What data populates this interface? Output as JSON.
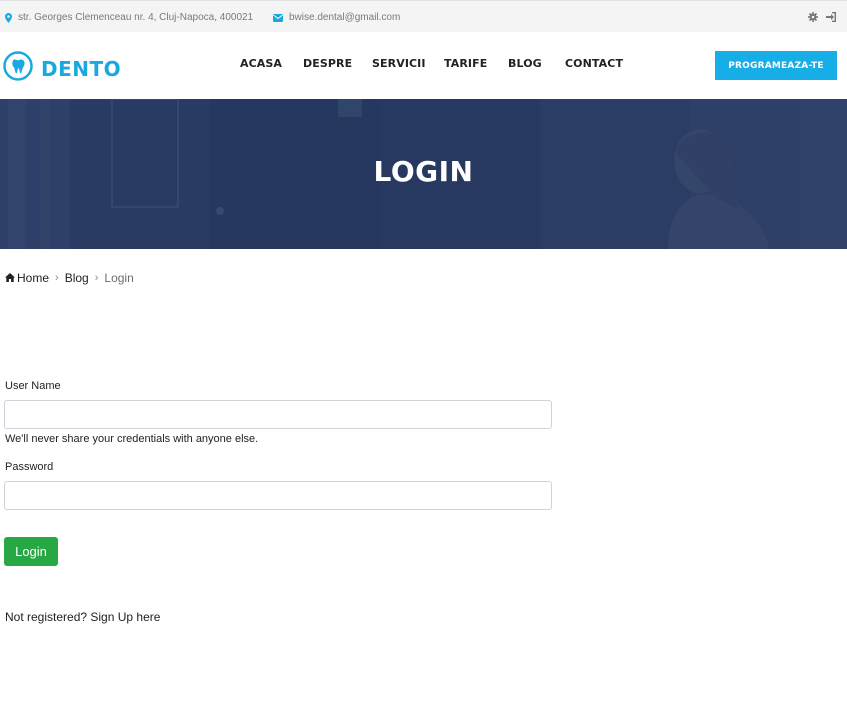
{
  "topbar": {
    "address": "str. Georges Clemenceau nr. 4, Cluj-Napoca, 400021",
    "email": "bwise.dental@gmail.com",
    "settings_icon": "gear-icon",
    "login_icon": "sign-in-icon"
  },
  "header": {
    "logo_text": "DENTO",
    "nav": [
      "ACASA",
      "DESPRE",
      "SERVICII",
      "TARIFE",
      "BLOG",
      "CONTACT"
    ],
    "cta_label": "PROGRAMEAZA-TE"
  },
  "hero": {
    "title": "LOGIN"
  },
  "breadcrumb": {
    "home": "Home",
    "blog": "Blog",
    "current": "Login"
  },
  "form": {
    "username_label": "User Name",
    "username_value": "",
    "username_help": "We'll never share your credentials with anyone else.",
    "password_label": "Password",
    "password_value": "",
    "submit_label": "Login",
    "signup_text": "Not registered? Sign Up here"
  },
  "colors": {
    "brand": "#19a9e0",
    "cta": "#17aee7",
    "hero_overlay": "#2d3e66",
    "submit": "#28a745"
  }
}
